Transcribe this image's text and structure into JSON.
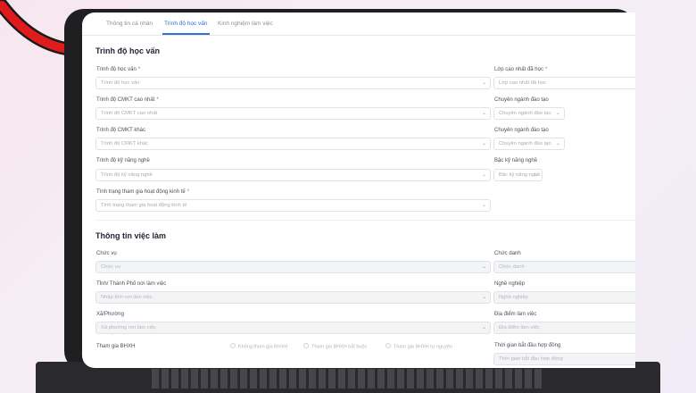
{
  "tabs": [
    "Thông tin cá nhân",
    "Trình độ học vấn",
    "Kinh nghiệm làm việc"
  ],
  "education": {
    "title": "Trình độ học vấn",
    "level_label": "Trình độ học vấn",
    "level_placeholder": "Trình độ học vấn",
    "highest_grade_label": "Lớp cao nhất đã học",
    "highest_grade_placeholder": "Lớp cao nhất đã học",
    "cmkt_highest_label": "Trình độ CMKT cao nhất",
    "cmkt_highest_placeholder": "Trình độ CMKT cao nhất",
    "major1_label": "Chuyên ngành đào tạo",
    "major1_placeholder": "Chuyên ngành đào tạo",
    "cmkt_other_label": "Trình độ CMKT khác",
    "cmkt_other_placeholder": "Trình độ CMKT khác",
    "major2_label": "Chuyên ngành đào tạo",
    "major2_placeholder": "Chuyên ngành đào tạo",
    "skill_label": "Trình độ kỹ năng nghề",
    "skill_placeholder": "Trình độ kỹ năng nghề",
    "skill_grade_label": "Bậc kỹ năng nghề",
    "skill_grade_placeholder": "Bậc kỹ năng nghề",
    "econ_label": "Tình trạng tham gia hoạt động kinh tế",
    "econ_placeholder": "Tình trạng tham gia hoạt động kinh tế"
  },
  "job": {
    "title": "Thông tin việc làm",
    "position_label": "Chức vụ",
    "position_placeholder": "Chức vụ",
    "jobtitle_label": "Chức danh",
    "jobtitle_placeholder": "Chức danh",
    "province_label": "Tỉnh/ Thành Phố nơi làm việc",
    "province_placeholder": "Nhập tỉnh nơi làm việc",
    "occupation_label": "Nghề nghiệp",
    "occupation_placeholder": "Nghề nghiệp",
    "ward_label": "Xã/Phường",
    "ward_placeholder": "Xã phường nơi làm việc",
    "workplace_label": "Địa điểm làm việc",
    "workplace_placeholder": "Địa điểm làm việc",
    "bhxh_label": "Tham gia BHXH",
    "bhxh_options": [
      "Không tham gia BHXH",
      "Tham gia BHXH bắt buộc",
      "Tham gia BHXH tự nguyện"
    ],
    "contract_start_label": "Thời gian bắt đầu hợp đồng",
    "contract_start_placeholder": "Thời gian bắt đầu hợp đồng"
  }
}
